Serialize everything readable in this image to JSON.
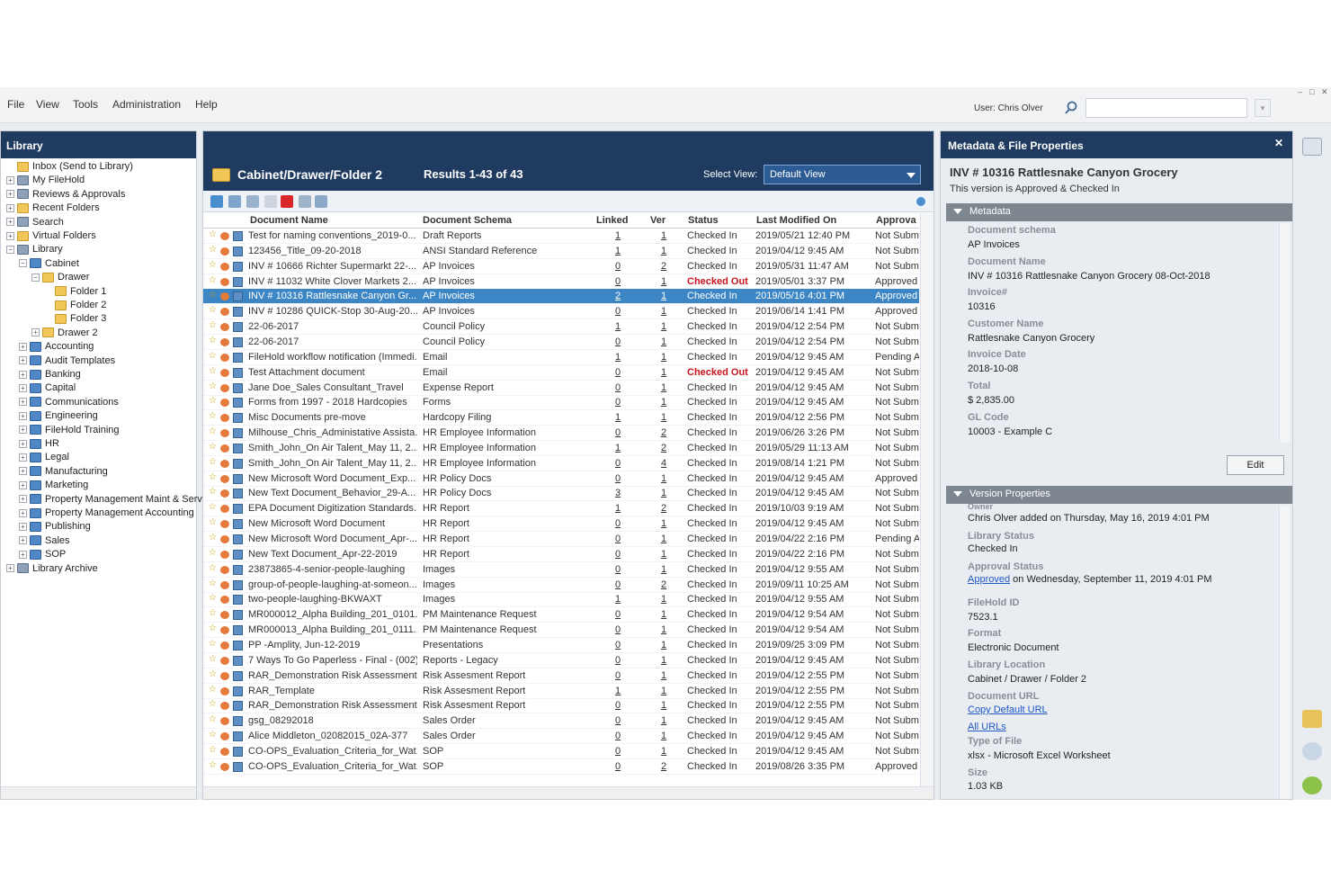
{
  "menu": [
    "File",
    "View",
    "Tools",
    "Administration",
    "Help"
  ],
  "user_label": "User: Chris Olver",
  "search": {
    "placeholder": ""
  },
  "library": {
    "title": "Library",
    "tree": [
      {
        "label": "Inbox (Send to Library)",
        "icon": "folder-icon",
        "expand": ""
      },
      {
        "label": "My FileHold",
        "icon": "users-icon",
        "expand": "+"
      },
      {
        "label": "Reviews & Approvals",
        "icon": "approvals-icon",
        "expand": "+"
      },
      {
        "label": "Recent Folders",
        "icon": "folder-icon",
        "expand": "+"
      },
      {
        "label": "Search",
        "icon": "search-icon",
        "expand": "+"
      },
      {
        "label": "Virtual Folders",
        "icon": "folder-icon",
        "expand": "+"
      },
      {
        "label": "Library",
        "icon": "library-icon",
        "expand": "−"
      },
      {
        "label": "Cabinet",
        "icon": "cabinet-icon",
        "expand": "−"
      },
      {
        "label": "Drawer",
        "icon": "drawer-icon",
        "expand": "−"
      },
      {
        "label": "Folder 1",
        "icon": "folder-icon",
        "expand": ""
      },
      {
        "label": "Folder 2",
        "icon": "folder-icon",
        "expand": ""
      },
      {
        "label": "Folder 3",
        "icon": "folder-icon",
        "expand": ""
      },
      {
        "label": "Drawer 2",
        "icon": "drawer-icon",
        "expand": "+"
      },
      {
        "label": "Accounting",
        "icon": "cabinet-icon",
        "expand": "+"
      },
      {
        "label": "Audit Templates",
        "icon": "cabinet-icon",
        "expand": "+"
      },
      {
        "label": "Banking",
        "icon": "cabinet-icon",
        "expand": "+"
      },
      {
        "label": "Capital",
        "icon": "cabinet-icon",
        "expand": "+"
      },
      {
        "label": "Communications",
        "icon": "cabinet-icon",
        "expand": "+"
      },
      {
        "label": "Engineering",
        "icon": "cabinet-icon",
        "expand": "+"
      },
      {
        "label": "FileHold Training",
        "icon": "cabinet-icon",
        "expand": "+"
      },
      {
        "label": "HR",
        "icon": "cabinet-icon",
        "expand": "+"
      },
      {
        "label": "Legal",
        "icon": "cabinet-icon",
        "expand": "+"
      },
      {
        "label": "Manufacturing",
        "icon": "cabinet-icon",
        "expand": "+"
      },
      {
        "label": "Marketing",
        "icon": "cabinet-icon",
        "expand": "+"
      },
      {
        "label": "Property Management  Maint & Serv",
        "icon": "cabinet-icon",
        "expand": "+"
      },
      {
        "label": "Property Management Accounting",
        "icon": "cabinet-icon",
        "expand": "+"
      },
      {
        "label": "Publishing",
        "icon": "cabinet-icon",
        "expand": "+"
      },
      {
        "label": "Sales",
        "icon": "cabinet-icon",
        "expand": "+"
      },
      {
        "label": "SOP",
        "icon": "cabinet-icon",
        "expand": "+"
      },
      {
        "label": "Library Archive",
        "icon": "archive-icon",
        "expand": "+"
      }
    ]
  },
  "docs": {
    "folder_path": "Cabinet/Drawer/Folder 2",
    "results": "Results 1-43 of 43",
    "select_view_label": "Select View:",
    "view_value": "Default View",
    "columns": [
      "Document Name",
      "Document Schema",
      "Linked",
      "Ver",
      "Status",
      "Last Modified On",
      "Approva"
    ],
    "rows": [
      {
        "name": "Test for naming conventions_2019-0...",
        "schema": "Draft Reports",
        "linked": "1",
        "ver": "1",
        "status": "Checked In",
        "modified": "2019/05/21 12:40 PM",
        "approval": "Not Subm"
      },
      {
        "name": "123456_Title_09-20-2018",
        "schema": "ANSI Standard Reference",
        "linked": "1",
        "ver": "1",
        "status": "Checked In",
        "modified": "2019/04/12 9:45 AM",
        "approval": "Not Subm"
      },
      {
        "name": "INV # 10666 Richter Supermarkt 22-...",
        "schema": "AP Invoices",
        "linked": "0",
        "ver": "2",
        "status": "Checked In",
        "modified": "2019/05/31 11:47 AM",
        "approval": "Not Subm"
      },
      {
        "name": "INV # 11032 White Clover Markets 2...",
        "schema": "AP Invoices",
        "linked": "0",
        "ver": "1",
        "status": "Checked Out",
        "modified": "2019/05/01 3:37 PM",
        "approval": "Approved"
      },
      {
        "name": "INV # 10316 Rattlesnake Canyon Gr...",
        "schema": "AP Invoices",
        "linked": "2",
        "ver": "1",
        "status": "Checked In",
        "modified": "2019/05/16 4:01 PM",
        "approval": "Approved",
        "selected": true
      },
      {
        "name": "INV # 10286 QUICK-Stop 30-Aug-20...",
        "schema": "AP Invoices",
        "linked": "0",
        "ver": "1",
        "status": "Checked In",
        "modified": "2019/06/14 1:41 PM",
        "approval": "Approved"
      },
      {
        "name": "22-06-2017",
        "schema": "Council Policy",
        "linked": "1",
        "ver": "1",
        "status": "Checked In",
        "modified": "2019/04/12 2:54 PM",
        "approval": "Not Subm"
      },
      {
        "name": "22-06-2017",
        "schema": "Council Policy",
        "linked": "0",
        "ver": "1",
        "status": "Checked In",
        "modified": "2019/04/12 2:54 PM",
        "approval": "Not Subm"
      },
      {
        "name": "FileHold workflow notification (Immedi...",
        "schema": "Email",
        "linked": "1",
        "ver": "1",
        "status": "Checked In",
        "modified": "2019/04/12 9:45 AM",
        "approval": "Pending A"
      },
      {
        "name": "Test Attachment document",
        "schema": "Email",
        "linked": "0",
        "ver": "1",
        "status": "Checked Out",
        "modified": "2019/04/12 9:45 AM",
        "approval": "Not Subm"
      },
      {
        "name": "Jane Doe_Sales Consultant_Travel",
        "schema": "Expense Report",
        "linked": "0",
        "ver": "1",
        "status": "Checked In",
        "modified": "2019/04/12 9:45 AM",
        "approval": "Not Subm"
      },
      {
        "name": "Forms from 1997 - 2018 Hardcopies",
        "schema": "Forms",
        "linked": "0",
        "ver": "1",
        "status": "Checked In",
        "modified": "2019/04/12 9:45 AM",
        "approval": "Not Subm"
      },
      {
        "name": "Misc Documents pre-move",
        "schema": "Hardcopy Filing",
        "linked": "1",
        "ver": "1",
        "status": "Checked In",
        "modified": "2019/04/12 2:56 PM",
        "approval": "Not Subm"
      },
      {
        "name": "Milhouse_Chris_Administative Assista...",
        "schema": "HR Employee Information",
        "linked": "0",
        "ver": "2",
        "status": "Checked In",
        "modified": "2019/06/26 3:26 PM",
        "approval": "Not Subm"
      },
      {
        "name": "Smith_John_On Air Talent_May 11, 2...",
        "schema": "HR Employee Information",
        "linked": "1",
        "ver": "2",
        "status": "Checked In",
        "modified": "2019/05/29 11:13 AM",
        "approval": "Not Subm"
      },
      {
        "name": "Smith_John_On Air Talent_May 11, 2...",
        "schema": "HR Employee Information",
        "linked": "0",
        "ver": "4",
        "status": "Checked In",
        "modified": "2019/08/14 1:21 PM",
        "approval": "Not Subm"
      },
      {
        "name": "New Microsoft Word Document_Exp...",
        "schema": "HR Policy Docs",
        "linked": "0",
        "ver": "1",
        "status": "Checked In",
        "modified": "2019/04/12 9:45 AM",
        "approval": "Approved"
      },
      {
        "name": "New Text Document_Behavior_29-A...",
        "schema": "HR Policy Docs",
        "linked": "3",
        "ver": "1",
        "status": "Checked In",
        "modified": "2019/04/12 9:45 AM",
        "approval": "Not Subm"
      },
      {
        "name": "EPA Document Digitization Standards...",
        "schema": "HR Report",
        "linked": "1",
        "ver": "2",
        "status": "Checked In",
        "modified": "2019/10/03 9:19 AM",
        "approval": "Not Subm"
      },
      {
        "name": "New Microsoft Word Document",
        "schema": "HR Report",
        "linked": "0",
        "ver": "1",
        "status": "Checked In",
        "modified": "2019/04/12 9:45 AM",
        "approval": "Not Subm"
      },
      {
        "name": "New Microsoft Word Document_Apr-...",
        "schema": "HR Report",
        "linked": "0",
        "ver": "1",
        "status": "Checked In",
        "modified": "2019/04/22 2:16 PM",
        "approval": "Pending A"
      },
      {
        "name": "New Text Document_Apr-22-2019",
        "schema": "HR Report",
        "linked": "0",
        "ver": "1",
        "status": "Checked In",
        "modified": "2019/04/22 2:16 PM",
        "approval": "Not Subm"
      },
      {
        "name": "23873865-4-senior-people-laughing",
        "schema": "Images",
        "linked": "0",
        "ver": "1",
        "status": "Checked In",
        "modified": "2019/04/12 9:55 AM",
        "approval": "Not Subm"
      },
      {
        "name": "group-of-people-laughing-at-someon...",
        "schema": "Images",
        "linked": "0",
        "ver": "2",
        "status": "Checked In",
        "modified": "2019/09/11 10:25 AM",
        "approval": "Not Subm"
      },
      {
        "name": "two-people-laughing-BKWAXT",
        "schema": "Images",
        "linked": "1",
        "ver": "1",
        "status": "Checked In",
        "modified": "2019/04/12 9:55 AM",
        "approval": "Not Subm"
      },
      {
        "name": "MR000012_Alpha Building_201_0101...",
        "schema": "PM Maintenance Request",
        "linked": "0",
        "ver": "1",
        "status": "Checked In",
        "modified": "2019/04/12 9:54 AM",
        "approval": "Not Subm"
      },
      {
        "name": "MR000013_Alpha Building_201_0111...",
        "schema": "PM Maintenance Request",
        "linked": "0",
        "ver": "1",
        "status": "Checked In",
        "modified": "2019/04/12 9:54 AM",
        "approval": "Not Subm"
      },
      {
        "name": "PP -Amplity, Jun-12-2019",
        "schema": "Presentations",
        "linked": "0",
        "ver": "1",
        "status": "Checked In",
        "modified": "2019/09/25 3:09 PM",
        "approval": "Not Subm"
      },
      {
        "name": "7 Ways To Go Paperless - Final - (002)",
        "schema": "Reports - Legacy",
        "linked": "0",
        "ver": "1",
        "status": "Checked In",
        "modified": "2019/04/12 9:45 AM",
        "approval": "Not Subm"
      },
      {
        "name": "RAR_Demonstration Risk Assessment...",
        "schema": "Risk Assesment Report",
        "linked": "0",
        "ver": "1",
        "status": "Checked In",
        "modified": "2019/04/12 2:55 PM",
        "approval": "Not Subm"
      },
      {
        "name": "RAR_Template",
        "schema": "Risk Assesment Report",
        "linked": "1",
        "ver": "1",
        "status": "Checked In",
        "modified": "2019/04/12 2:55 PM",
        "approval": "Not Subm"
      },
      {
        "name": "RAR_Demonstration Risk Assessment...",
        "schema": "Risk Assesment Report",
        "linked": "0",
        "ver": "1",
        "status": "Checked In",
        "modified": "2019/04/12 2:55 PM",
        "approval": "Not Subm"
      },
      {
        "name": "gsg_08292018",
        "schema": "Sales Order",
        "linked": "0",
        "ver": "1",
        "status": "Checked In",
        "modified": "2019/04/12 9:45 AM",
        "approval": "Not Subm"
      },
      {
        "name": "Alice Middleton_02082015_02A-377",
        "schema": "Sales Order",
        "linked": "0",
        "ver": "1",
        "status": "Checked In",
        "modified": "2019/04/12 9:45 AM",
        "approval": "Not Subm"
      },
      {
        "name": "CO-OPS_Evaluation_Criteria_for_Wat...",
        "schema": "SOP",
        "linked": "0",
        "ver": "1",
        "status": "Checked In",
        "modified": "2019/04/12 9:45 AM",
        "approval": "Not Subm"
      },
      {
        "name": "CO-OPS_Evaluation_Criteria_for_Wat...",
        "schema": "SOP",
        "linked": "0",
        "ver": "2",
        "status": "Checked In",
        "modified": "2019/08/26 3:35 PM",
        "approval": "Approved"
      }
    ]
  },
  "meta": {
    "title": "Metadata & File Properties",
    "doc_title": "INV # 10316 Rattlesnake Canyon Grocery",
    "version_note": "This version is Approved & Checked In",
    "metadata_section": "Metadata",
    "metadata_fields": [
      {
        "label": "Document schema",
        "value": "AP Invoices"
      },
      {
        "label": "Document Name",
        "value": "INV # 10316 Rattlesnake Canyon Grocery 08-Oct-2018"
      },
      {
        "label": "Invoice#",
        "value": "10316"
      },
      {
        "label": "Customer Name",
        "value": "Rattlesnake Canyon Grocery"
      },
      {
        "label": "Invoice Date",
        "value": "2018-10-08"
      },
      {
        "label": "Total",
        "value": "$ 2,835.00"
      },
      {
        "label": "GL Code",
        "value": "10003 - Example C"
      }
    ],
    "edit_label": "Edit",
    "version_section": "Version Properties",
    "owner_label": "Owner",
    "owner_value": "Chris Olver added on Thursday, May 16, 2019 4:01 PM",
    "library_status_label": "Library Status",
    "library_status_value": "Checked In",
    "approval_status_label": "Approval Status",
    "approval_link": "Approved",
    "approval_rest": " on Wednesday, September 11, 2019 4:01 PM",
    "filehold_id_label": "FileHold ID",
    "filehold_id_value": "7523.1",
    "format_label": "Format",
    "format_value": "Electronic Document",
    "location_label": "Library Location",
    "location_value": "Cabinet / Drawer / Folder 2",
    "url_label": "Document URL",
    "copy_url": "Copy Default URL",
    "all_urls": "All URLs",
    "type_label": "Type of File",
    "type_value": "xlsx - Microsoft Excel Worksheet",
    "size_label": "Size",
    "size_value": "1.03 KB"
  },
  "colors": {
    "header_navy": "#1f3b5f",
    "selection": "#3d86c6",
    "checked_out": "#c8141e",
    "link": "#1e57c8"
  }
}
